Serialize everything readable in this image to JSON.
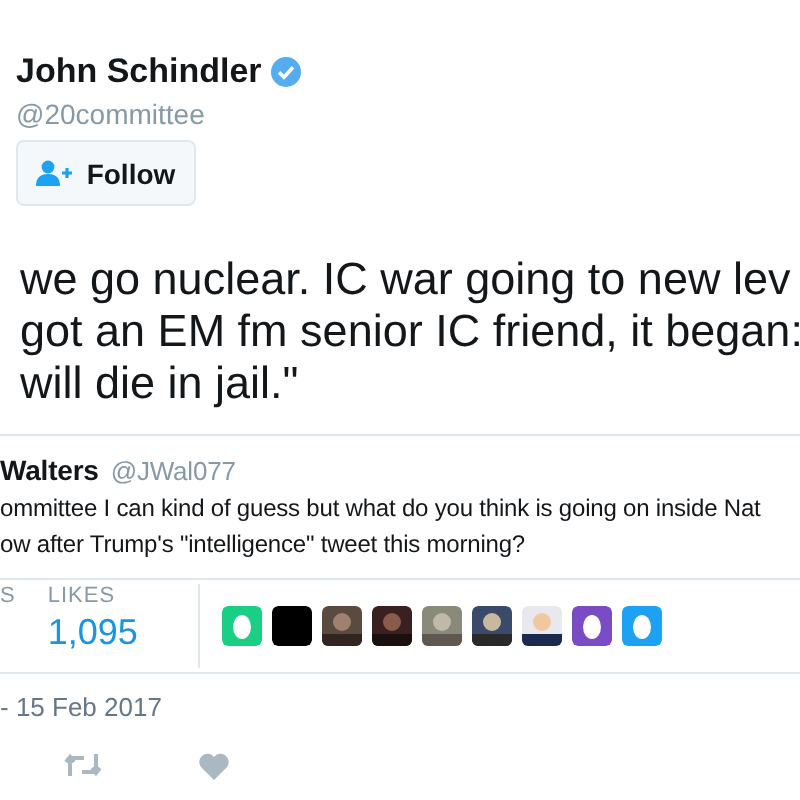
{
  "author": {
    "name": "John Schindler",
    "verified": true,
    "handle": "@20committee"
  },
  "follow_button": {
    "label": "Follow"
  },
  "tweet_lines": [
    "we go nuclear. IC war going to new lev",
    "got an EM fm senior IC friend, it began:",
    "will die in jail.\""
  ],
  "quoted_tweet": {
    "name": "Walters",
    "handle": "@JWal077",
    "lines": [
      "ommittee I can kind of guess but what do you think is going on inside Nat",
      "ow after Trump's \"intelligence\" tweet this morning?"
    ]
  },
  "stats": [
    {
      "label": "S"
    },
    {
      "label": "LIKES",
      "value": "1,095"
    }
  ],
  "likers": [
    {
      "kind": "egg",
      "color": "#19cf86"
    },
    {
      "kind": "plain",
      "color": "#000000"
    },
    {
      "kind": "picture"
    },
    {
      "kind": "picture"
    },
    {
      "kind": "picture"
    },
    {
      "kind": "picture"
    },
    {
      "kind": "picture"
    },
    {
      "kind": "egg",
      "color": "#794bc4"
    },
    {
      "kind": "egg",
      "color": "#1da1f2"
    }
  ],
  "date": "- 15 Feb 2017"
}
